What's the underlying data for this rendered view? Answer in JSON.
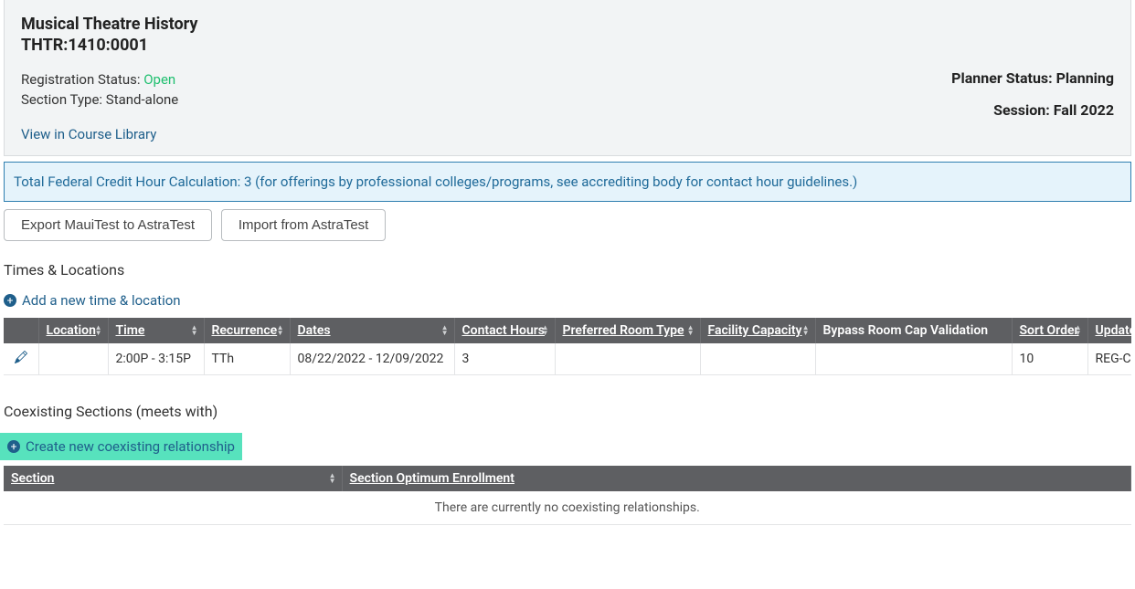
{
  "header": {
    "course_title": "Musical Theatre History",
    "course_code": "THTR:1410:0001",
    "reg_label": "Registration Status: ",
    "reg_status": "Open",
    "section_type_label": "Section Type: ",
    "section_type": "Stand-alone",
    "library_link": "View in Course Library",
    "planner_status_label": "Planner Status: ",
    "planner_status": "Planning",
    "session_label": "Session: ",
    "session": "Fall 2022"
  },
  "credit_banner": "Total Federal Credit Hour Calculation: 3 (for offerings by professional colleges/programs, see accrediting body for contact hour guidelines.)",
  "buttons": {
    "export": "Export MauiTest to AstraTest",
    "import": "Import from AstraTest"
  },
  "times_locations": {
    "title": "Times & Locations",
    "add_link": "Add a new time & location",
    "columns": {
      "location": "Location",
      "time": "Time",
      "recurrence": "Recurrence",
      "dates": "Dates",
      "contact_hours": "Contact Hours",
      "preferred_room_type": "Preferred Room Type",
      "facility_capacity": "Facility Capacity",
      "bypass": "Bypass Room Cap Validation",
      "sort_order": "Sort Order",
      "updated_by": "Updated By"
    },
    "rows": [
      {
        "location": "",
        "time": "2:00P - 3:15P",
        "recurrence": "TTh",
        "dates": "08/22/2022 - 12/09/2022",
        "contact_hours": "3",
        "preferred_room_type": "",
        "facility_capacity": "",
        "bypass": "",
        "sort_order": "10",
        "updated_by": "REG-CO"
      }
    ]
  },
  "coexisting": {
    "title": "Coexisting Sections (meets with)",
    "create_link": "Create new coexisting relationship",
    "columns": {
      "section": "Section",
      "optimum": "Section Optimum Enrollment"
    },
    "empty_msg": "There are currently no coexisting relationships."
  }
}
